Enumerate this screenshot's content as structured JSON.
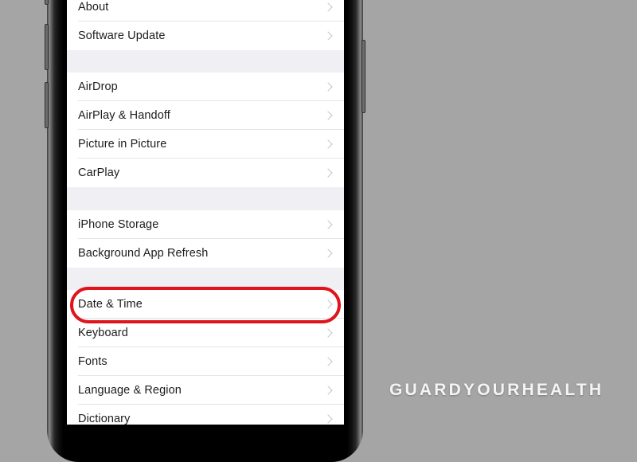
{
  "settings_screen": {
    "groups": [
      {
        "items": [
          {
            "label": "About"
          },
          {
            "label": "Software Update"
          }
        ]
      },
      {
        "items": [
          {
            "label": "AirDrop"
          },
          {
            "label": "AirPlay & Handoff"
          },
          {
            "label": "Picture in Picture"
          },
          {
            "label": "CarPlay"
          }
        ]
      },
      {
        "items": [
          {
            "label": "iPhone Storage"
          },
          {
            "label": "Background App Refresh"
          }
        ]
      },
      {
        "items": [
          {
            "label": "Date & Time",
            "highlighted": true
          },
          {
            "label": "Keyboard"
          },
          {
            "label": "Fonts"
          },
          {
            "label": "Language & Region"
          },
          {
            "label": "Dictionary"
          }
        ]
      }
    ],
    "chevron_icon": "chevron-right-icon"
  },
  "annotation": {
    "highlight_target": "Date & Time",
    "highlight_color": "#e0141b"
  },
  "watermark": {
    "text": "GUARDYOURHEALTH"
  }
}
